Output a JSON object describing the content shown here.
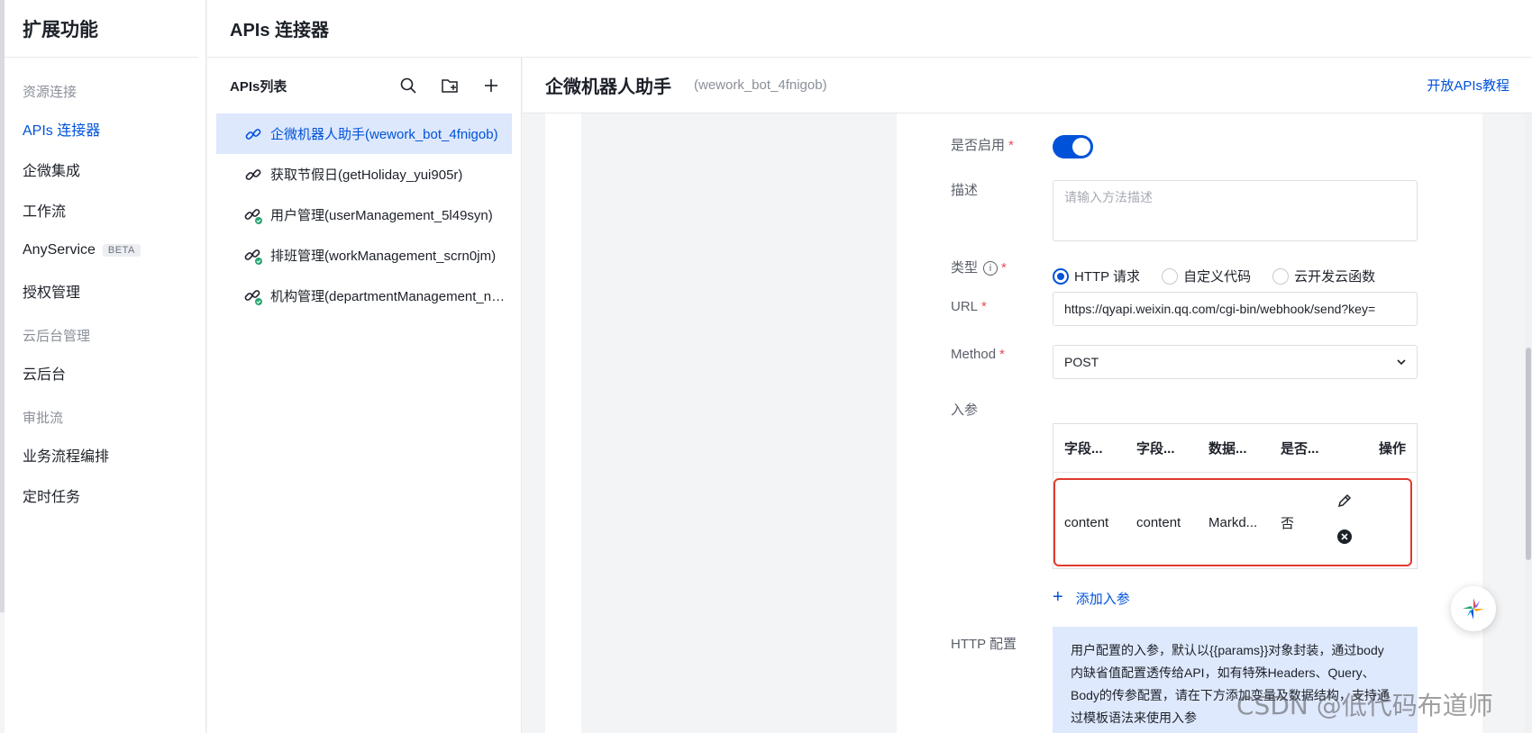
{
  "sidebar": {
    "title": "扩展功能",
    "sections": [
      {
        "group": "资源连接",
        "items": [
          {
            "label": "APIs 连接器",
            "active": true
          },
          {
            "label": "企微集成"
          },
          {
            "label": "工作流"
          },
          {
            "label": "AnyService",
            "badge": "BETA"
          },
          {
            "label": "授权管理"
          }
        ]
      },
      {
        "group": "云后台管理",
        "items": [
          {
            "label": "云后台"
          }
        ]
      },
      {
        "group": "审批流",
        "items": [
          {
            "label": "业务流程编排"
          },
          {
            "label": "定时任务"
          }
        ]
      }
    ]
  },
  "topbar": {
    "title": "APIs 连接器"
  },
  "api_list": {
    "title": "APIs列表",
    "items": [
      {
        "label": "企微机器人助手(wework_bot_4fnigob)",
        "active": true,
        "status": "plain"
      },
      {
        "label": "获取节假日(getHoliday_yui905r)",
        "status": "plain"
      },
      {
        "label": "用户管理(userManagement_5l49syn)",
        "status": "ok"
      },
      {
        "label": "排班管理(workManagement_scrn0jm)",
        "status": "ok"
      },
      {
        "label": "机构管理(departmentManagement_n2kt...",
        "status": "ok"
      }
    ]
  },
  "detail": {
    "name": "企微机器人助手",
    "code": "(wework_bot_4fnigob)",
    "tutorial_link": "开放APIs教程",
    "form": {
      "enabled_label": "是否启用",
      "enabled": true,
      "desc_label": "描述",
      "desc_placeholder": "请输入方法描述",
      "type_label": "类型",
      "type_options": [
        "HTTP 请求",
        "自定义代码",
        "云开发云函数"
      ],
      "type_selected": "HTTP 请求",
      "url_label": "URL",
      "url_value": "https://qyapi.weixin.qq.com/cgi-bin/webhook/send?key=",
      "method_label": "Method",
      "method_value": "POST",
      "params_label": "入参",
      "params_columns": [
        "字段...",
        "字段...",
        "数据...",
        "是否..."
      ],
      "params_op_label": "操作",
      "params_rows": [
        {
          "cells": [
            "content",
            "content",
            "Markd...",
            "否"
          ]
        }
      ],
      "add_param": "添加入参",
      "http_label": "HTTP 配置",
      "http_hint": "用户配置的入参，默认以{{params}}对象封装，通过body 内缺省值配置透传给API，如有特殊Headers、Query、Body的传参配置，请在下方添加变量及数据结构，支持通过模板语法来使用入参"
    }
  },
  "watermark": "CSDN @低代码布道师",
  "colors": {
    "accent": "#0052d9",
    "required": "#e34d59",
    "highlight_border": "#e03a2f"
  }
}
